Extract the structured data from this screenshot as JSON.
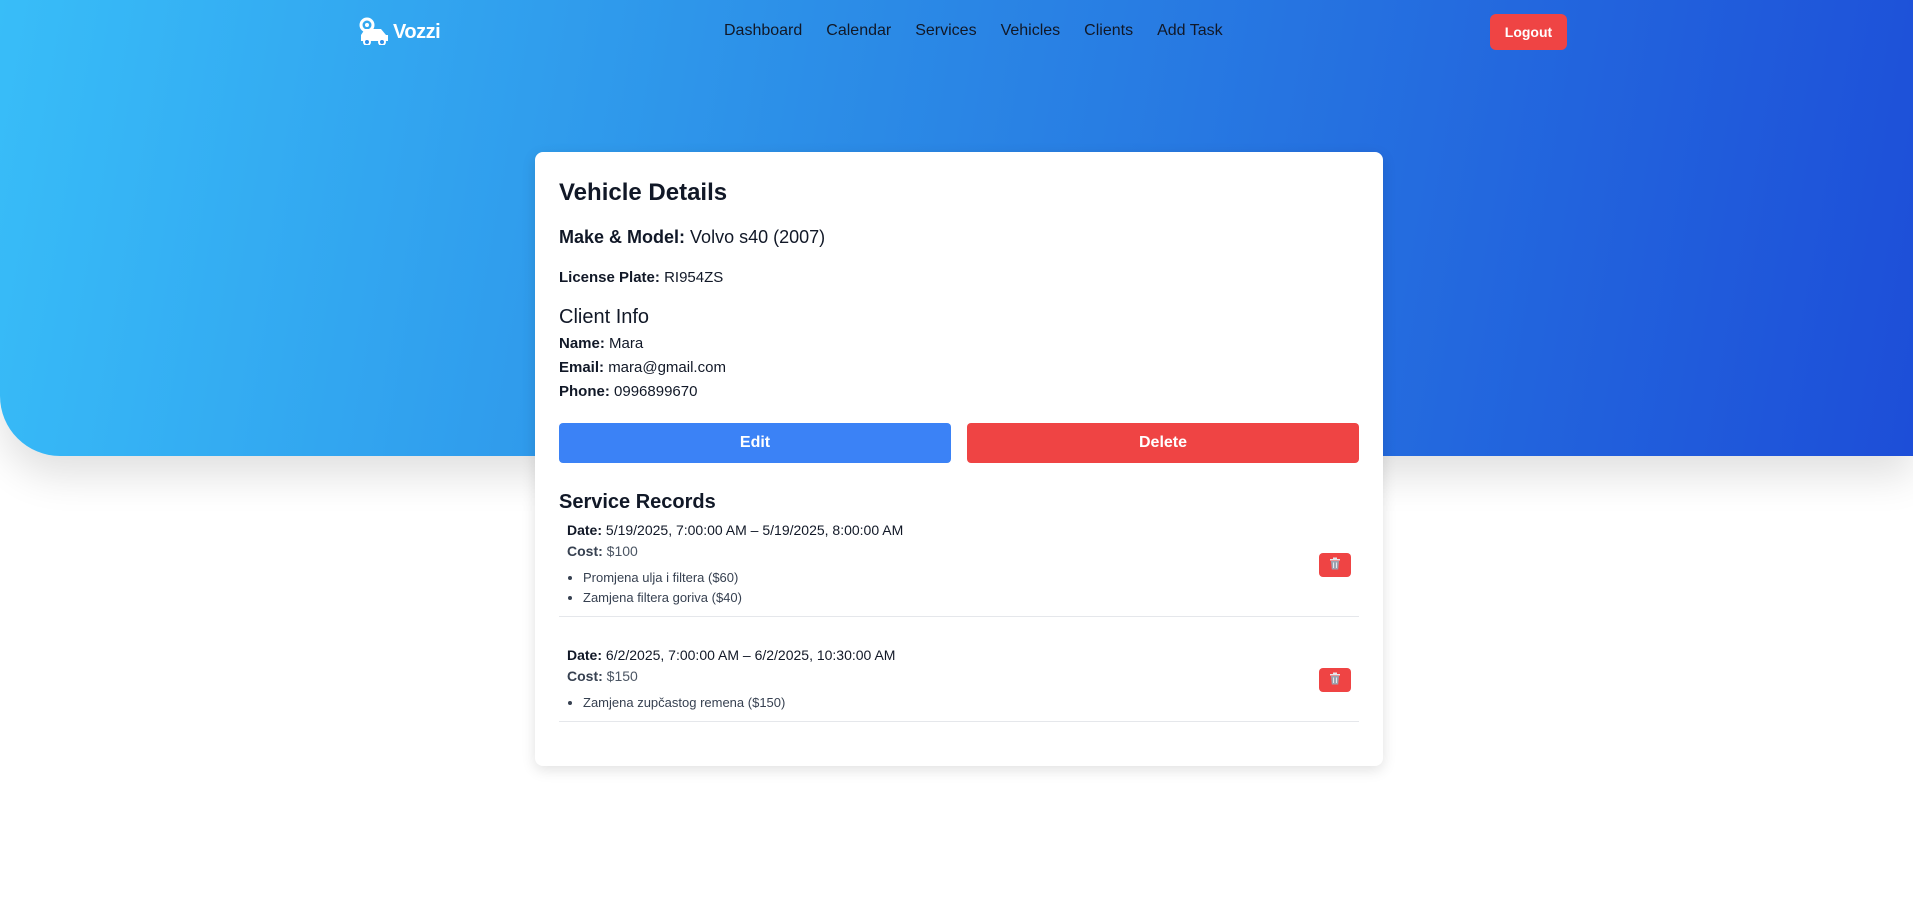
{
  "app": {
    "logo_text": "Vozzi",
    "logo_icon": "car-gear-icon"
  },
  "nav": {
    "links": [
      "Dashboard",
      "Calendar",
      "Services",
      "Vehicles",
      "Clients",
      "Add Task"
    ],
    "logout_label": "Logout"
  },
  "vehicle": {
    "title": "Vehicle Details",
    "make_label": "Make & Model:",
    "make_value": "Volvo s40 (2007)",
    "plate_label": "License Plate:",
    "plate_value": "RI954ZS"
  },
  "client": {
    "title": "Client Info",
    "name_label": "Name:",
    "name_value": "Mara",
    "email_label": "Email:",
    "email_value": "mara@gmail.com",
    "phone_label": "Phone:",
    "phone_value": "0996899670"
  },
  "actions": {
    "edit_label": "Edit",
    "delete_label": "Delete"
  },
  "records": {
    "title": "Service Records",
    "date_label": "Date:",
    "cost_label": "Cost:",
    "items": [
      {
        "date": "5/19/2025, 7:00:00 AM – 5/19/2025, 8:00:00 AM",
        "cost": "$100",
        "services": [
          "Promjena ulja i filtera ($60)",
          "Zamjena filtera goriva ($40)"
        ]
      },
      {
        "date": "6/2/2025, 7:00:00 AM – 6/2/2025, 10:30:00 AM",
        "cost": "$150",
        "services": [
          "Zamjena zupčastog remena ($150)"
        ]
      }
    ]
  },
  "colors": {
    "primary": "#3b82f6",
    "danger": "#ef4444",
    "gradient_start": "#38bdf8",
    "gradient_end": "#1d4ed8"
  }
}
